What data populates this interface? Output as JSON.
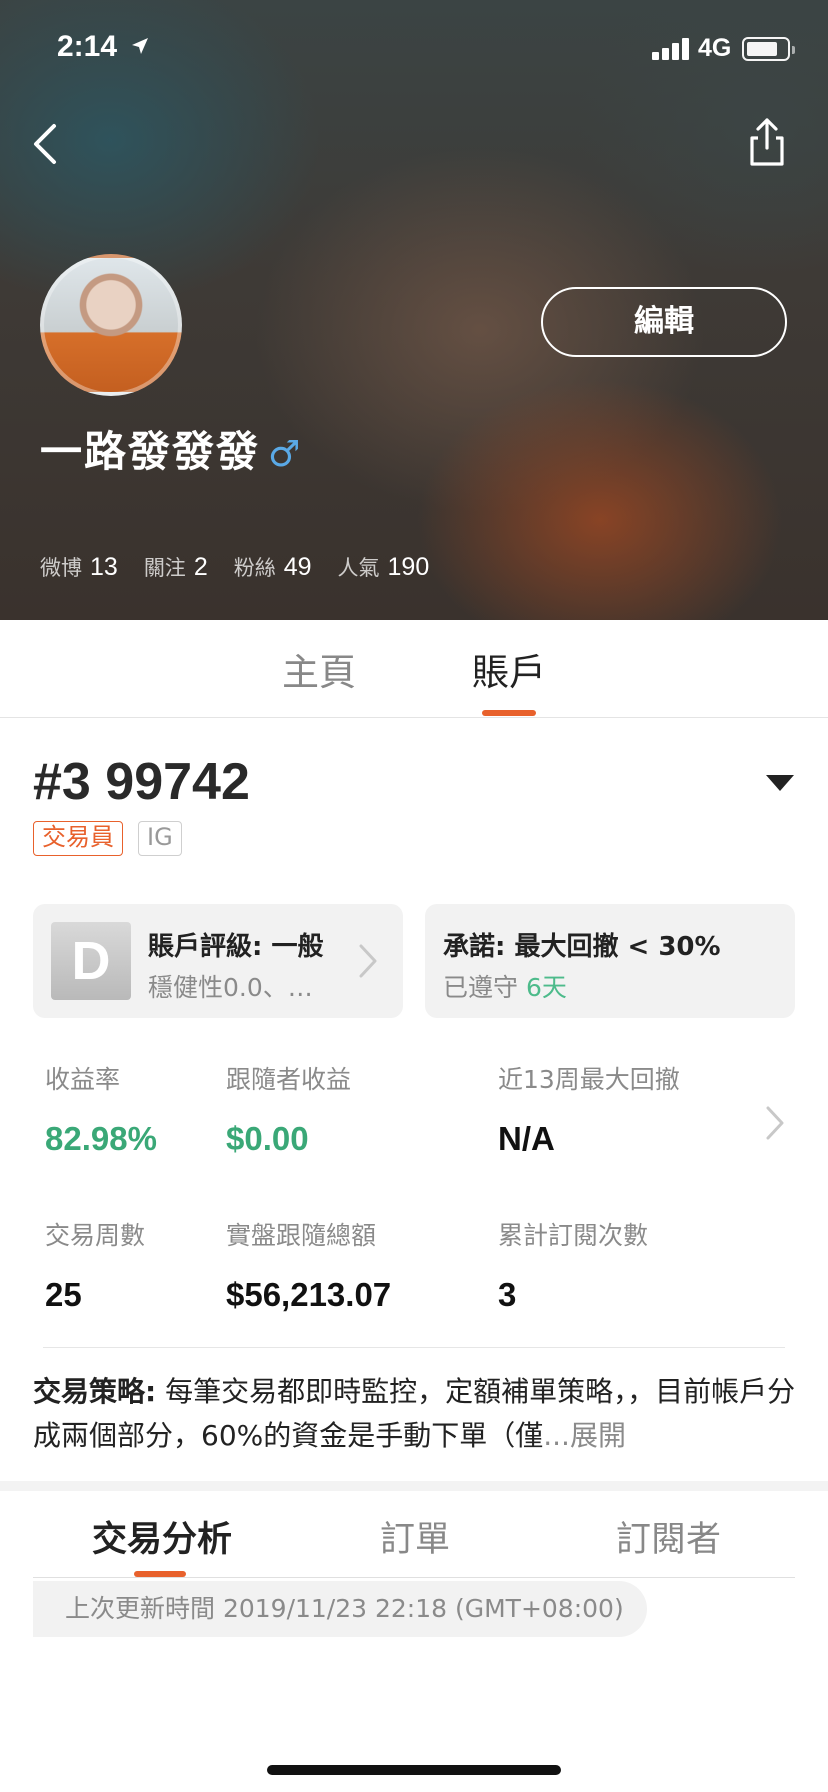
{
  "status_bar": {
    "time": "2:14",
    "network": "4G"
  },
  "profile": {
    "username": "一路發發發",
    "gender_symbol": "♂",
    "edit_label": "編輯",
    "stats": [
      {
        "label": "微博",
        "value": "13"
      },
      {
        "label": "關注",
        "value": "2"
      },
      {
        "label": "粉絲",
        "value": "49"
      },
      {
        "label": "人氣",
        "value": "190"
      }
    ]
  },
  "tabs": {
    "home": "主頁",
    "account": "賬戶"
  },
  "account": {
    "number": "#3 99742",
    "tags": {
      "trader": "交易員",
      "broker": "IG"
    },
    "rating_card": {
      "grade": "D",
      "title": "賬戶評級: 一般",
      "subtitle": "穩健性0.0、…"
    },
    "promise_card": {
      "title": "承諾: 最大回撤 < 30%",
      "kept_label": "已遵守",
      "kept_value": "6天"
    },
    "metrics": [
      {
        "label": "收益率",
        "value": "82.98%"
      },
      {
        "label": "跟隨者收益",
        "value": "$0.00"
      },
      {
        "label": "近13周最大回撤",
        "value": "N/A"
      },
      {
        "label": "交易周數",
        "value": "25"
      },
      {
        "label": "實盤跟隨總額",
        "value": "$56,213.07"
      },
      {
        "label": "累計訂閱次數",
        "value": "3"
      }
    ],
    "strategy": {
      "label": "交易策略:",
      "text": " 每筆交易都即時監控，定額補單策略，，目前帳戶分成兩個部分，60%的資金是手動下單（僅",
      "more": "...展開"
    }
  },
  "subtabs": {
    "analysis": "交易分析",
    "orders": "訂單",
    "subscribers": "訂閱者"
  },
  "updated_text": "上次更新時間 2019/11/23 22:18 (GMT+08:00)",
  "colors": {
    "accent": "#e8612c",
    "positive": "#3aa877",
    "male": "#5aa9e6"
  }
}
